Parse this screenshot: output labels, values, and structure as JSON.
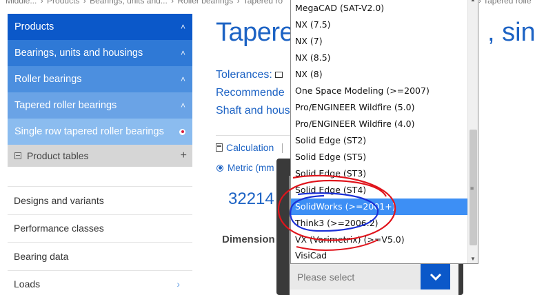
{
  "breadcrumb": {
    "items": [
      "Middle...",
      "Products",
      "Bearings, units and...",
      "Roller bearings",
      "Tapered ro"
    ],
    "separator": "›",
    "right": "› Tapered rolle"
  },
  "sidebar": {
    "nav": [
      {
        "label": "Products",
        "chevron": "˄"
      },
      {
        "label": "Bearings, units and housings",
        "chevron": "˄"
      },
      {
        "label": "Roller bearings",
        "chevron": "˄"
      },
      {
        "label": "Tapered roller bearings",
        "chevron": "˄"
      },
      {
        "label": "Single row tapered roller bearings"
      }
    ],
    "product_tables": {
      "label": "Product tables",
      "toggle": "+"
    },
    "links": [
      {
        "label": "Designs and variants"
      },
      {
        "label": "Performance classes"
      },
      {
        "label": "Bearing data"
      },
      {
        "label": "Loads",
        "chevron": "›"
      }
    ]
  },
  "main": {
    "title_left": "Tapere",
    "title_right": ", sing",
    "tolerances": "Tolerances:",
    "recommended": "Recommende",
    "shaft": "Shaft and hous",
    "calc_tab": "Calculation",
    "metric": "Metric (mm",
    "part_number": "32214",
    "dimensions": "Dimension"
  },
  "dropdown": {
    "options": [
      "MegaCAD (SAT-V2.0)",
      "NX (7.5)",
      "NX (7)",
      "NX (8.5)",
      "NX (8)",
      "One Space Modeling (>=2007)",
      "Pro/ENGINEER Wildfire (5.0)",
      "Pro/ENGINEER Wildfire (4.0)",
      "Solid Edge (ST2)",
      "Solid Edge (ST5)",
      "Solid Edge (ST3)",
      "Solid Edge (ST4)",
      "SolidWorks (>=2001+)",
      "Think3 (>=2006.2)",
      "VX (Varimetrix) (>=V5.0)",
      "VisiCad"
    ],
    "selected_index": 12,
    "placeholder": "Please select",
    "scroll_glyphs": {
      "up": "▲",
      "down": "▼",
      "grip": "≡"
    }
  },
  "colors": {
    "brand_blue": "#0b58c9",
    "link_blue": "#1d63c4",
    "selection_blue": "#3d8ff5",
    "annotation_red": "#e0141c",
    "annotation_blue": "#1a2fd6"
  }
}
